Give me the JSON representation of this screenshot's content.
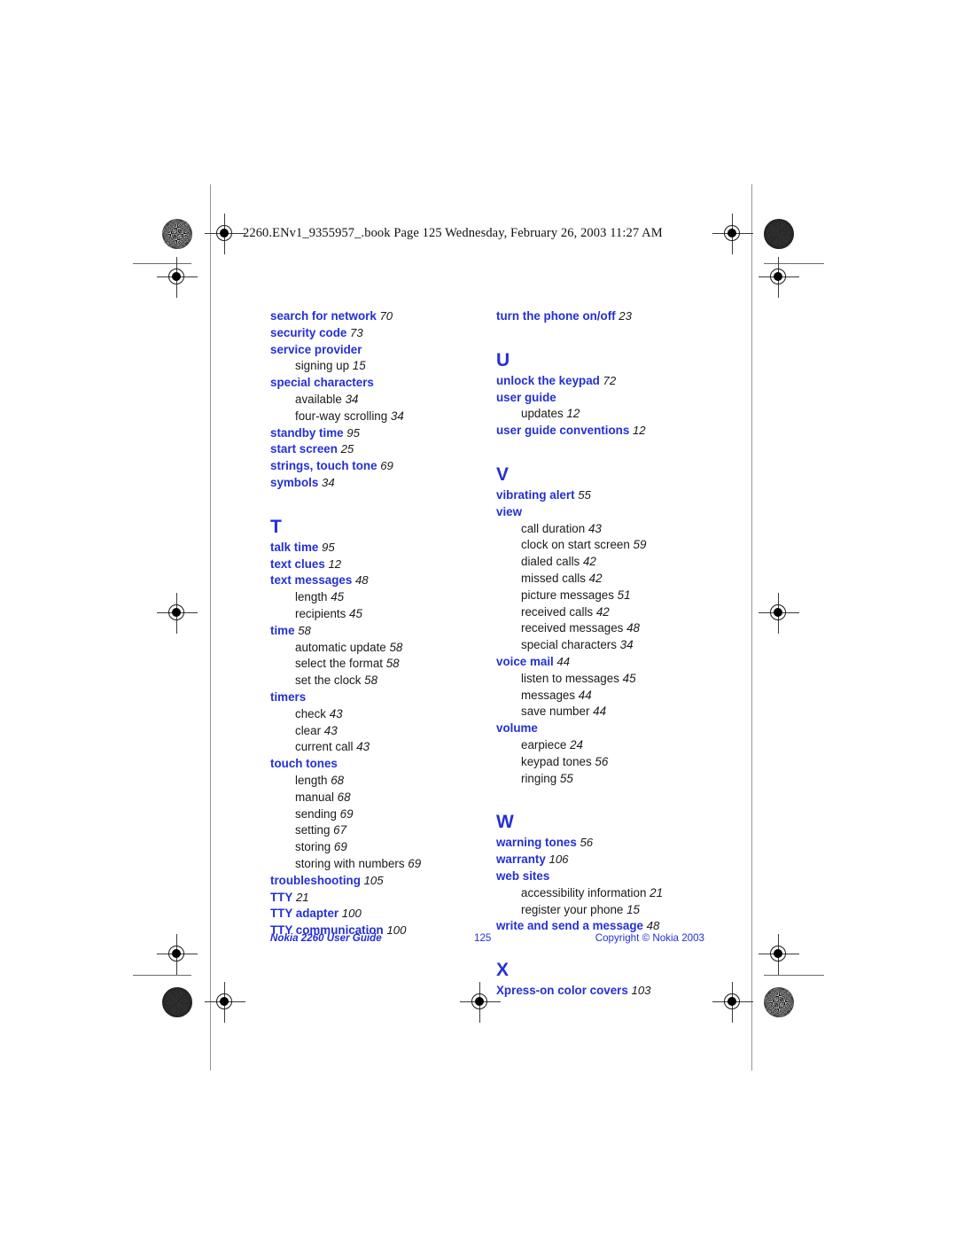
{
  "page": {
    "header_line": "2260.ENv1_9355957_.book  Page 125  Wednesday, February 26, 2003  11:27 AM",
    "accent_color": "#2430d4",
    "text_color": "#1a1a1a"
  },
  "footer": {
    "left": "Nokia 2260 User Guide",
    "center": "125",
    "right": "Copyright © Nokia 2003"
  },
  "columns": [
    {
      "id": "left",
      "blocks": [
        {
          "letter": "",
          "entries": [
            {
              "label": "search for network",
              "page": "70",
              "subs": []
            },
            {
              "label": "security code",
              "page": "73",
              "subs": []
            },
            {
              "label": "service provider",
              "page": "",
              "subs": [
                {
                  "label": "signing up",
                  "page": "15"
                }
              ]
            },
            {
              "label": "special characters",
              "page": "",
              "subs": [
                {
                  "label": "available",
                  "page": "34"
                },
                {
                  "label": "four-way scrolling",
                  "page": "34"
                }
              ]
            },
            {
              "label": "standby time",
              "page": "95",
              "subs": []
            },
            {
              "label": "start screen",
              "page": "25",
              "subs": []
            },
            {
              "label": "strings, touch tone",
              "page": "69",
              "subs": []
            },
            {
              "label": "symbols",
              "page": "34",
              "subs": []
            }
          ]
        },
        {
          "letter": "T",
          "entries": [
            {
              "label": "talk time",
              "page": "95",
              "subs": []
            },
            {
              "label": "text clues",
              "page": "12",
              "subs": []
            },
            {
              "label": "text messages",
              "page": "48",
              "subs": [
                {
                  "label": "length",
                  "page": "45"
                },
                {
                  "label": "recipients",
                  "page": "45"
                }
              ]
            },
            {
              "label": "time",
              "page": "58",
              "subs": [
                {
                  "label": "automatic update",
                  "page": "58"
                },
                {
                  "label": "select the format",
                  "page": "58"
                },
                {
                  "label": "set the clock",
                  "page": "58"
                }
              ]
            },
            {
              "label": "timers",
              "page": "",
              "subs": [
                {
                  "label": "check",
                  "page": "43"
                },
                {
                  "label": "clear",
                  "page": "43"
                },
                {
                  "label": "current call",
                  "page": "43"
                }
              ]
            },
            {
              "label": "touch tones",
              "page": "",
              "subs": [
                {
                  "label": "length",
                  "page": "68"
                },
                {
                  "label": "manual",
                  "page": "68"
                },
                {
                  "label": "sending",
                  "page": "69"
                },
                {
                  "label": "setting",
                  "page": "67"
                },
                {
                  "label": "storing",
                  "page": "69"
                },
                {
                  "label": "storing with numbers",
                  "page": "69"
                }
              ]
            },
            {
              "label": "troubleshooting",
              "page": "105",
              "subs": []
            },
            {
              "label": "TTY",
              "page": "21",
              "subs": []
            },
            {
              "label": "TTY adapter",
              "page": "100",
              "subs": []
            },
            {
              "label": "TTY communication",
              "page": "100",
              "subs": []
            }
          ]
        }
      ]
    },
    {
      "id": "right",
      "blocks": [
        {
          "letter": "",
          "entries": [
            {
              "label": "turn the phone on/off",
              "page": "23",
              "subs": []
            }
          ]
        },
        {
          "letter": "U",
          "entries": [
            {
              "label": "unlock the keypad",
              "page": "72",
              "subs": []
            },
            {
              "label": "user guide",
              "page": "",
              "subs": [
                {
                  "label": "updates",
                  "page": "12"
                }
              ]
            },
            {
              "label": "user guide conventions",
              "page": "12",
              "subs": []
            }
          ]
        },
        {
          "letter": "V",
          "entries": [
            {
              "label": "vibrating alert",
              "page": "55",
              "subs": []
            },
            {
              "label": "view",
              "page": "",
              "subs": [
                {
                  "label": "call duration",
                  "page": "43"
                },
                {
                  "label": "clock on start screen",
                  "page": "59"
                },
                {
                  "label": "dialed calls",
                  "page": "42"
                },
                {
                  "label": "missed calls",
                  "page": "42"
                },
                {
                  "label": "picture messages",
                  "page": "51"
                },
                {
                  "label": "received calls",
                  "page": "42"
                },
                {
                  "label": "received messages",
                  "page": "48"
                },
                {
                  "label": "special characters",
                  "page": "34"
                }
              ]
            },
            {
              "label": "voice mail",
              "page": "44",
              "subs": [
                {
                  "label": "listen to messages",
                  "page": "45"
                },
                {
                  "label": "messages",
                  "page": "44"
                },
                {
                  "label": "save number",
                  "page": "44"
                }
              ]
            },
            {
              "label": "volume",
              "page": "",
              "subs": [
                {
                  "label": "earpiece",
                  "page": "24"
                },
                {
                  "label": "keypad tones",
                  "page": "56"
                },
                {
                  "label": "ringing",
                  "page": "55"
                }
              ]
            }
          ]
        },
        {
          "letter": "W",
          "entries": [
            {
              "label": "warning tones",
              "page": "56",
              "subs": []
            },
            {
              "label": "warranty",
              "page": "106",
              "subs": []
            },
            {
              "label": "web sites",
              "page": "",
              "subs": [
                {
                  "label": "accessibility information",
                  "page": "21"
                },
                {
                  "label": "register your phone",
                  "page": "15"
                }
              ]
            },
            {
              "label": "write and send a message",
              "page": "48",
              "subs": []
            }
          ]
        },
        {
          "letter": "X",
          "entries": [
            {
              "label": "Xpress-on color covers",
              "page": "103",
              "subs": []
            }
          ]
        }
      ]
    }
  ]
}
